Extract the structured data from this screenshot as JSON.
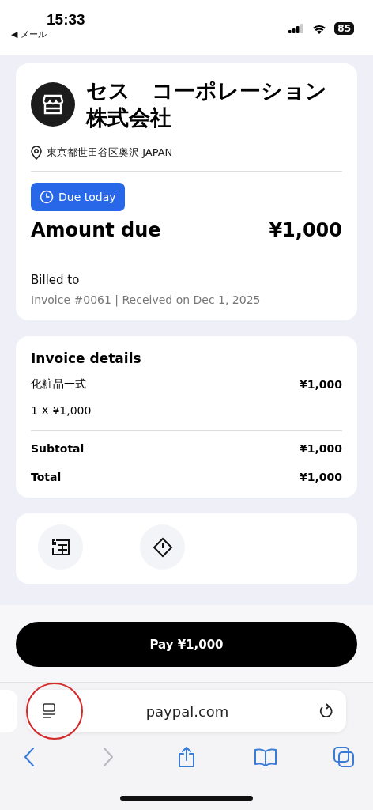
{
  "status_bar": {
    "time": "15:33",
    "back_app": "◀ メール",
    "battery": "85"
  },
  "merchant": {
    "name": "セス　コーポレーション株式会社",
    "address": "東京都世田谷区奥沢 JAPAN"
  },
  "due_badge": "Due today",
  "amount": {
    "label": "Amount due",
    "value": "¥1,000"
  },
  "billed_to": "Billed to",
  "invoice_meta": "Invoice #0061 | Received on Dec 1, 2025",
  "details": {
    "title": "Invoice details",
    "items": [
      {
        "name": "化粧品一式",
        "price": "¥1,000",
        "qty": "1 X ¥1,000"
      }
    ],
    "totals": [
      {
        "label": "Subtotal",
        "value": "¥1,000"
      },
      {
        "label": "Total",
        "value": "¥1,000"
      }
    ]
  },
  "pay_button": "Pay ¥1,000",
  "browser": {
    "url": "paypal.com",
    "toolbar": [
      {
        "kind": "back",
        "disabled": false
      },
      {
        "kind": "forward",
        "disabled": true
      },
      {
        "kind": "share",
        "disabled": false
      },
      {
        "kind": "bookmarks",
        "disabled": false
      },
      {
        "kind": "tabs",
        "disabled": false
      }
    ]
  }
}
